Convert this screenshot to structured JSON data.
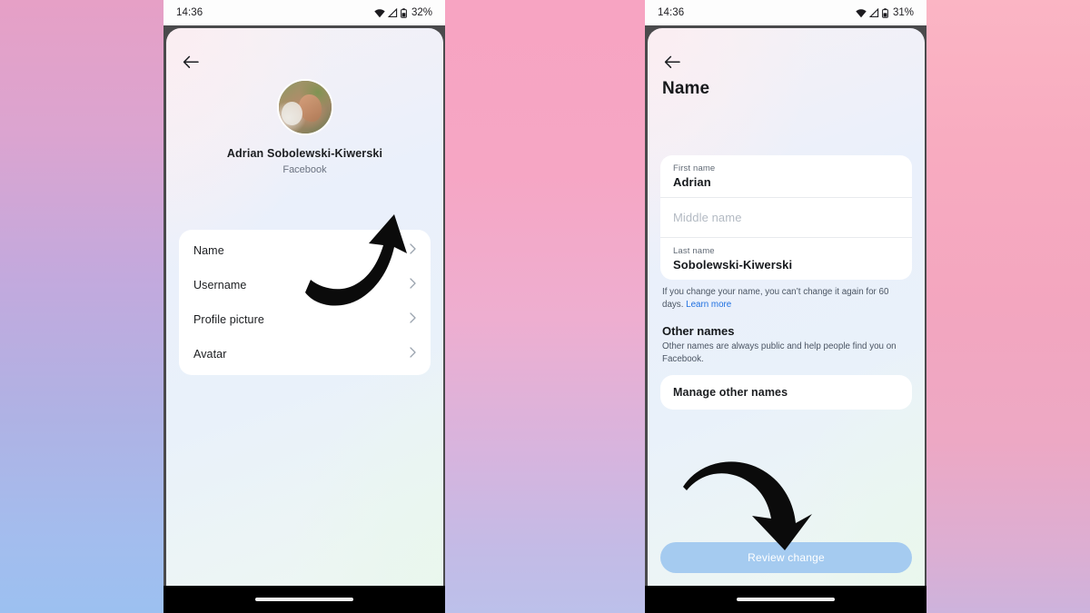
{
  "screens": [
    {
      "id": "profile-settings",
      "statusbar": {
        "time": "14:36",
        "battery": "32%",
        "wifi_icon": "wifi-icon",
        "signal_icon": "signal-icon",
        "battery_icon": "battery-icon"
      },
      "back_icon": "back-arrow-icon",
      "profile": {
        "name": "Adrian Sobolewski-Kiwerski",
        "source": "Facebook",
        "avatar_icon": "avatar"
      },
      "menu_items": [
        {
          "label": "Name",
          "chevron": "›"
        },
        {
          "label": "Username",
          "chevron": "›"
        },
        {
          "label": "Profile picture",
          "chevron": "›"
        },
        {
          "label": "Avatar",
          "chevron": "›"
        }
      ],
      "annotation_icon": "curved-arrow-up-right-icon"
    },
    {
      "id": "name-editor",
      "statusbar": {
        "time": "14:36",
        "battery": "31%",
        "wifi_icon": "wifi-icon",
        "signal_icon": "signal-icon",
        "battery_icon": "battery-icon"
      },
      "back_icon": "back-arrow-icon",
      "title": "Name",
      "fields": [
        {
          "label": "First name",
          "value": "Adrian",
          "placeholder": ""
        },
        {
          "label": "",
          "value": "",
          "placeholder": "Middle name"
        },
        {
          "label": "Last name",
          "value": "Sobolewski-Kiwerski",
          "placeholder": ""
        }
      ],
      "disclaimer": {
        "text": "If you change your name, you can’t change it again for 60 days. ",
        "link": "Learn more"
      },
      "other_names": {
        "title": "Other names",
        "description": "Other names are always public and help people find you on Facebook.",
        "manage_label": "Manage other names"
      },
      "cta": {
        "label": "Review change",
        "color": "#a5cbf0",
        "state": "disabled"
      },
      "annotation_icon": "curved-arrow-down-icon"
    }
  ],
  "colors": {
    "accent_link": "#1f6fe0",
    "cta_disabled": "#a5cbf0",
    "card": "#ffffff",
    "text_primary": "#15181c",
    "text_secondary": "#4b5563"
  }
}
